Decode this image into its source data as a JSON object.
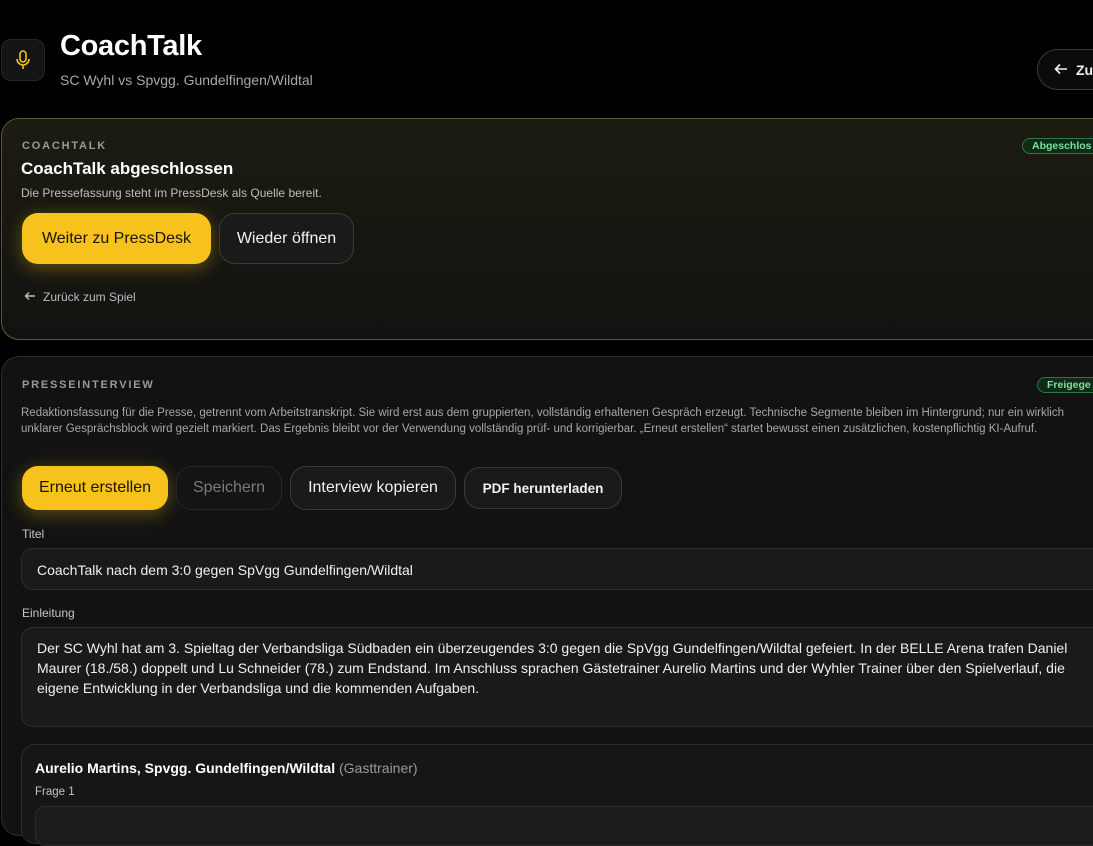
{
  "header": {
    "title": "CoachTalk",
    "subtitle": "SC Wyhl vs Spvgg. Gundelfingen/Wildtal",
    "back_label": "Zu",
    "icon": "microphone-icon",
    "accent_color": "#f7c21b"
  },
  "status_card": {
    "eyebrow": "COACHTALK",
    "badge": "Abgeschlos",
    "heading": "CoachTalk abgeschlossen",
    "description": "Die Pressefassung steht im PressDesk als Quelle bereit.",
    "primary_button": "Weiter zu PressDesk",
    "secondary_button": "Wieder öffnen",
    "back_link": "Zurück zum Spiel"
  },
  "interview_card": {
    "eyebrow": "PRESSEINTERVIEW",
    "badge": "Freigege",
    "description": "Redaktionsfassung für die Presse, getrennt vom Arbeitstranskript. Sie wird erst aus dem gruppierten, vollständig erhaltenen Gespräch erzeugt. Technische Segmente bleiben im Hintergrund; nur ein wirklich unklarer Gesprächsblock wird gezielt markiert. Das Ergebnis bleibt vor der Verwendung vollständig prüf- und korrigierbar. „Erneut erstellen“ startet bewusst einen zusätzlichen, kostenpflichtig KI-Aufruf.",
    "buttons": {
      "regenerate": "Erneut erstellen",
      "save": "Speichern",
      "copy": "Interview kopieren",
      "pdf": "PDF herunterladen"
    },
    "title_label": "Titel",
    "title_value": "CoachTalk nach dem 3:0 gegen SpVgg Gundelfingen/Wildtal",
    "intro_label": "Einleitung",
    "intro_value": "Der SC Wyhl hat am 3. Spieltag der Verbandsliga Südbaden ein überzeugendes 3:0 gegen die SpVgg Gundelfingen/Wildtal gefeiert. In der BELLE Arena trafen Daniel Maurer (18./58.) doppelt und Lu Schneider (78.) zum Endstand. Im Anschluss sprachen Gästetrainer Aurelio Martins und der Wyhler Trainer über den Spielverlauf, die eigene Entwicklung in der Verbandsliga und die kommenden Aufgaben.",
    "qa": {
      "speaker": "Aurelio Martins, Spvgg. Gundelfingen/Wildtal",
      "role": "(Gasttrainer)",
      "question_label": "Frage 1"
    }
  }
}
